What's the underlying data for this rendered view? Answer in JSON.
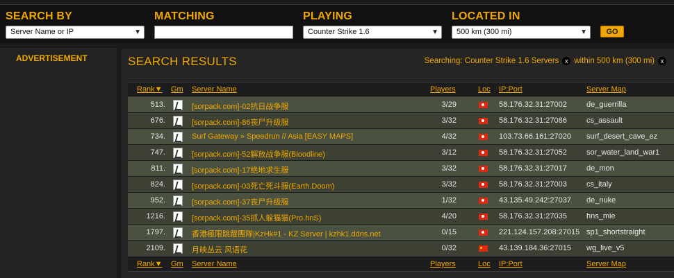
{
  "search": {
    "search_by_label": "SEARCH BY",
    "search_by_value": "Server Name or IP",
    "matching_label": "MATCHING",
    "matching_value": "",
    "playing_label": "PLAYING",
    "playing_value": "Counter Strike 1.6",
    "located_label": "LOCATED IN",
    "located_value": "500 km (300 mi)",
    "go_label": "GO"
  },
  "sidebar": {
    "ad_label": "ADVERTISEMENT"
  },
  "results": {
    "title": "SEARCH RESULTS",
    "searching_game": "Searching: Counter Strike 1.6 Servers",
    "searching_distance": "within 500 km (300 mi)",
    "remove_symbol": "x"
  },
  "table": {
    "headers": {
      "rank": "Rank▼",
      "gm": "Gm",
      "name": "Server Name",
      "players": "Players",
      "loc": "Loc",
      "ip": "IP:Port",
      "map": "Server Map"
    },
    "rows": [
      {
        "rank": "513.",
        "name": "[sorpack.com]-02抗日战争服",
        "players": "3/29",
        "flag": "hk",
        "ip": "58.176.32.31:27002",
        "map": "de_guerrilla"
      },
      {
        "rank": "676.",
        "name": "[sorpack.com]-86丧尸升级服",
        "players": "3/32",
        "flag": "hk",
        "ip": "58.176.32.31:27086",
        "map": "cs_assault"
      },
      {
        "rank": "734.",
        "name": "Surf Gateway » Speedrun // Asia [EASY MAPS]",
        "players": "4/32",
        "flag": "hk",
        "ip": "103.73.66.161:27020",
        "map": "surf_desert_cave_ez"
      },
      {
        "rank": "747.",
        "name": "[sorpack.com]-52解放战争服(Bloodline)",
        "players": "3/12",
        "flag": "hk",
        "ip": "58.176.32.31:27052",
        "map": "sor_water_land_war1"
      },
      {
        "rank": "811.",
        "name": "[sorpack.com]-17绝地求生服",
        "players": "3/32",
        "flag": "hk",
        "ip": "58.176.32.31:27017",
        "map": "de_mon"
      },
      {
        "rank": "824.",
        "name": "[sorpack.com]-03死亡死斗服(Earth.Doom)",
        "players": "3/32",
        "flag": "hk",
        "ip": "58.176.32.31:27003",
        "map": "cs_italy"
      },
      {
        "rank": "952.",
        "name": "[sorpack.com]-37丧尸升级服",
        "players": "1/32",
        "flag": "hk",
        "ip": "43.135.49.242:27037",
        "map": "de_nuke"
      },
      {
        "rank": "1216.",
        "name": "[sorpack.com]-35抓人躲猫猫(Pro.hnS)",
        "players": "4/20",
        "flag": "hk",
        "ip": "58.176.32.31:27035",
        "map": "hns_mie"
      },
      {
        "rank": "1797.",
        "name": "香港極限跳躍團隊|KzHk#1 - KZ Server | kzhk1.ddns.net",
        "players": "0/15",
        "flag": "hk",
        "ip": "221.124.157.208:27015",
        "map": "sp1_shortstraight"
      },
      {
        "rank": "2109.",
        "name": "月映丛云 风语花",
        "players": "0/32",
        "flag": "cn",
        "ip": "43.139.184.36:27015",
        "map": "wg_live_v5"
      }
    ]
  }
}
